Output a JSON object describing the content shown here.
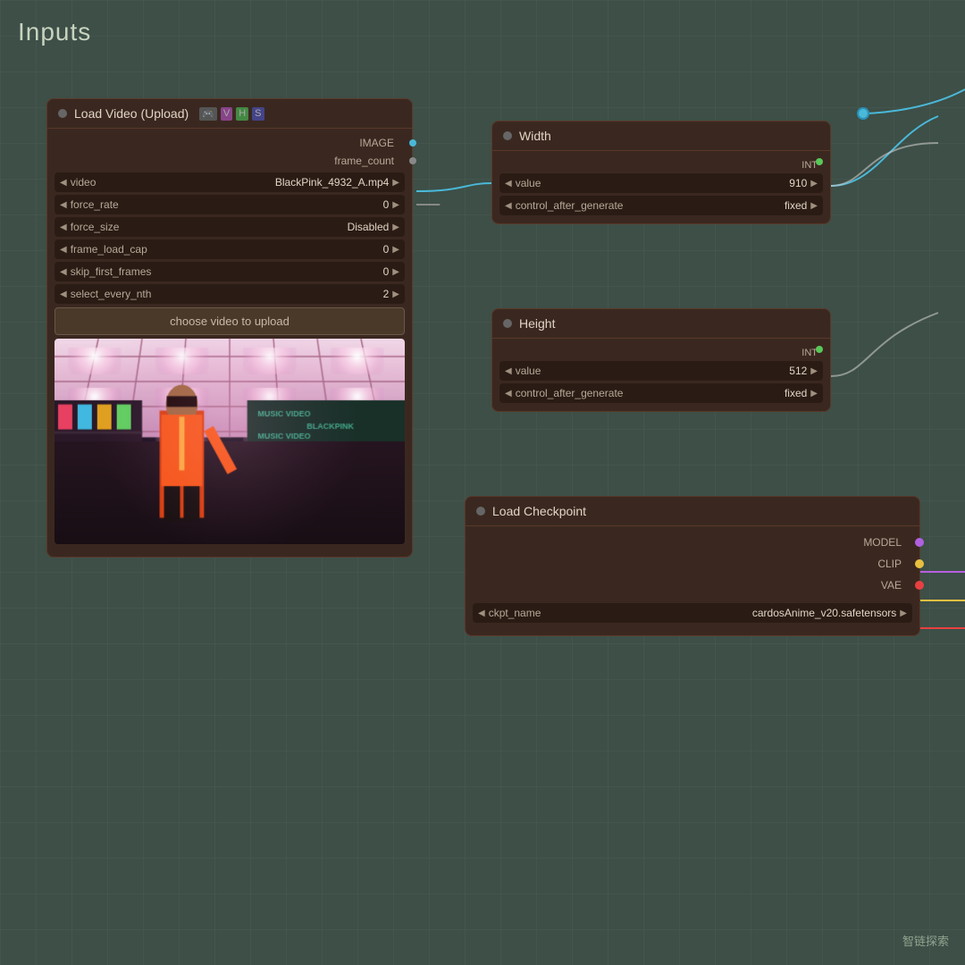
{
  "page": {
    "title": "Inputs",
    "watermark": "智链探索"
  },
  "nodes": {
    "load_video": {
      "title": "Load Video (Upload)",
      "icons": [
        "🎮",
        "V",
        "H",
        "S"
      ],
      "outputs": {
        "image_label": "IMAGE",
        "frame_count_label": "frame_count"
      },
      "fields": {
        "video": {
          "label": "video",
          "value": "BlackPink_4932_A.mp4"
        },
        "force_rate": {
          "label": "force_rate",
          "value": "0"
        },
        "force_size": {
          "label": "force_size",
          "value": "Disabled"
        },
        "frame_load_cap": {
          "label": "frame_load_cap",
          "value": "0"
        },
        "skip_first_frames": {
          "label": "skip_first_frames",
          "value": "0"
        },
        "select_every_nth": {
          "label": "select_every_nth",
          "value": "2"
        }
      },
      "upload_btn": "choose video to upload"
    },
    "width": {
      "title": "Width",
      "int_label": "INT",
      "value_field": {
        "label": "value",
        "value": "910"
      },
      "control_field": {
        "label": "control_after_generate",
        "value": "fixed"
      }
    },
    "height": {
      "title": "Height",
      "int_label": "INT",
      "value_field": {
        "label": "value",
        "value": "512"
      },
      "control_field": {
        "label": "control_after_generate",
        "value": "fixed"
      }
    },
    "checkpoint": {
      "title": "Load Checkpoint",
      "outputs": {
        "model": "MODEL",
        "clip": "CLIP",
        "vae": "VAE"
      },
      "ckpt_field": {
        "label": "ckpt_name",
        "value": "cardosAnime_v20.safetensors"
      }
    }
  }
}
